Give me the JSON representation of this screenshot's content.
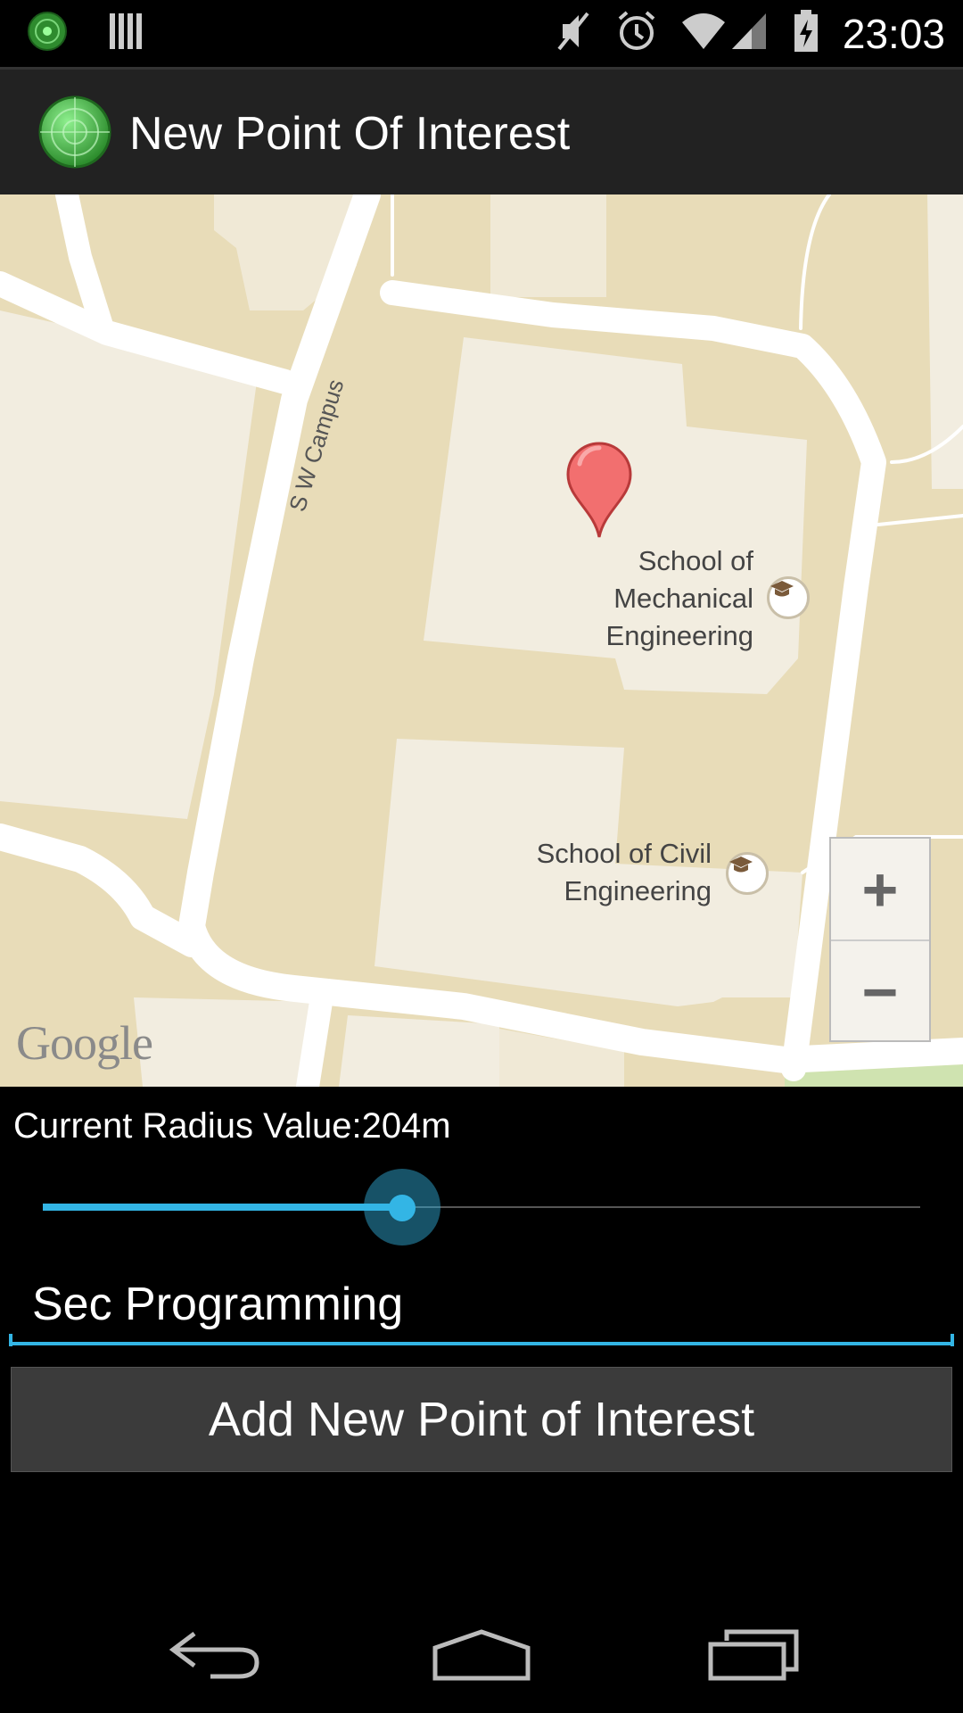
{
  "status_bar": {
    "time": "23:03",
    "left_icons": [
      "radar-notification-icon",
      "barcode-notification-icon"
    ],
    "right_icons": [
      "mute-icon",
      "alarm-icon",
      "wifi-icon",
      "signal-icon",
      "battery-charging-icon"
    ]
  },
  "action_bar": {
    "title": "New Point Of Interest",
    "icon": "radar-app-icon"
  },
  "map": {
    "street_label": "S W Campus",
    "places": [
      {
        "name": "School of\nMechanical\nEngineering",
        "icon": "graduation-cap-icon"
      },
      {
        "name": "School of Civil\nEngineering",
        "icon": "graduation-cap-icon"
      }
    ],
    "zoom_in_label": "+",
    "zoom_out_label": "−",
    "attribution": "Google",
    "marker_color": "#f26f6f"
  },
  "radius": {
    "label": "Current Radius Value:204m",
    "slider_fraction": 0.41
  },
  "name_field": {
    "value": "Sec Programming"
  },
  "add_button": {
    "label": "Add New Point of Interest"
  },
  "nav_bar": {
    "buttons": [
      "back-icon",
      "home-icon",
      "recent-apps-icon"
    ]
  },
  "colors": {
    "accent": "#33b5e5",
    "action_bar": "#222222",
    "map_background": "#e8dcb8"
  }
}
